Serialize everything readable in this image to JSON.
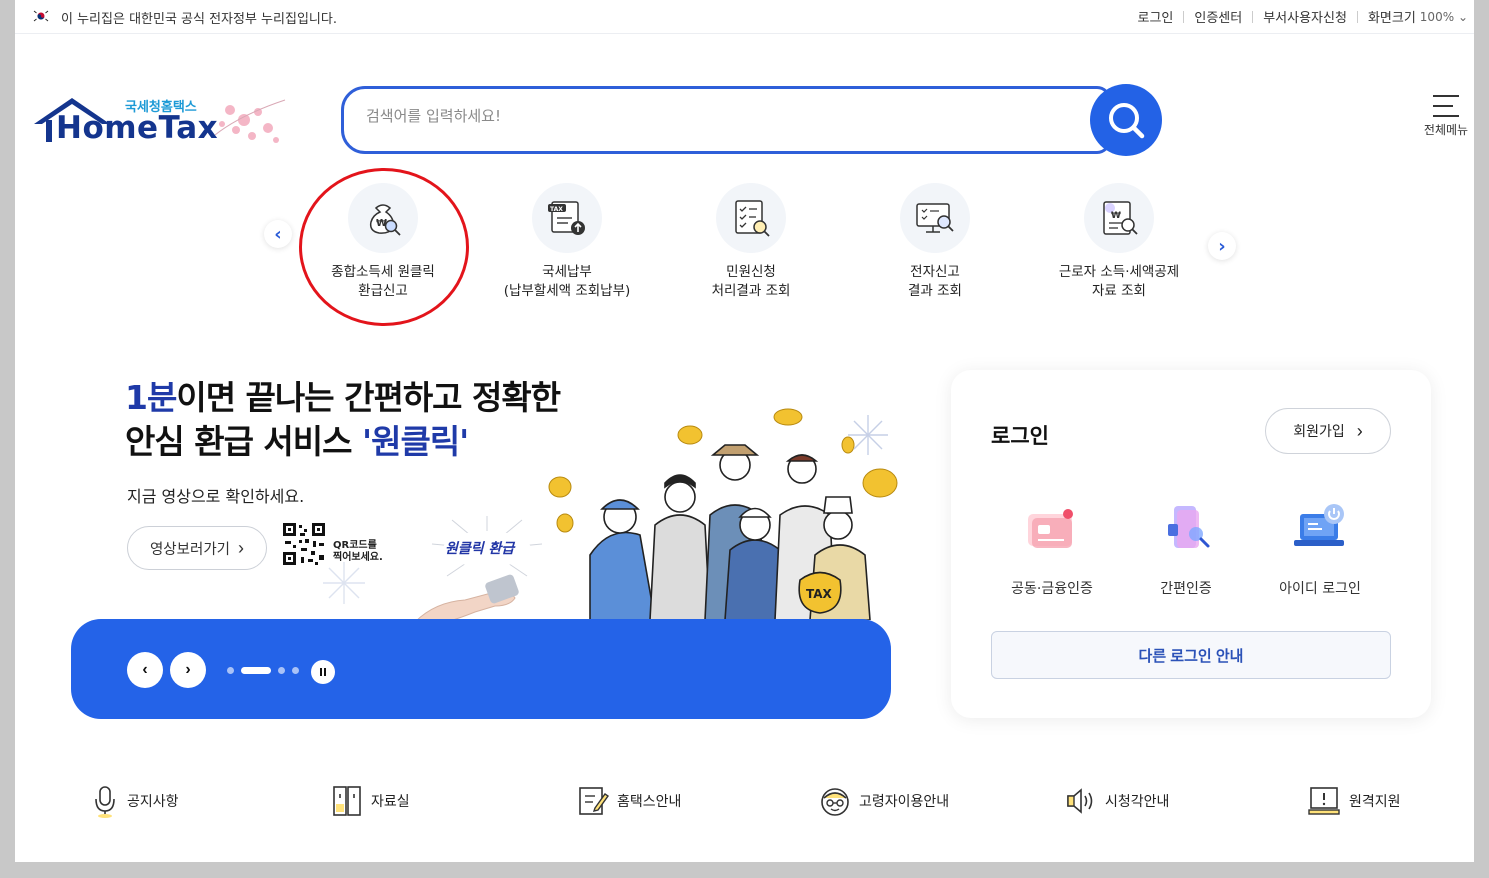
{
  "topbar": {
    "gov_notice": "이 누리집은 대한민국 공식 전자정부 누리집입니다.",
    "login": "로그인",
    "cert_center": "인증센터",
    "dept_user": "부서사용자신청",
    "screen_size": "화면크기",
    "zoom": "100%"
  },
  "logo": {
    "sub": "국세청홈택스",
    "main": "HomeTax"
  },
  "search": {
    "placeholder": "검색어를 입력하세요!"
  },
  "allmenu": {
    "label": "전체메뉴"
  },
  "quick_menu": [
    {
      "label": "종합소득세 원클릭\n환급신고",
      "icon": "money-bag-search-icon"
    },
    {
      "label": "국세납부\n(납부할세액 조회납부)",
      "icon": "tax-document-upload-icon"
    },
    {
      "label": "민원신청\n처리결과 조회",
      "icon": "checklist-search-icon"
    },
    {
      "label": "전자신고\n결과 조회",
      "icon": "monitor-search-icon"
    },
    {
      "label": "근로자 소득·세액공제\n자료 조회",
      "icon": "receipt-search-icon"
    }
  ],
  "banner": {
    "headline_emph": "1분",
    "headline_rest1": "이면 끝나는 간편하고 정확한",
    "headline_line2a": "안심 환급 서비스 ",
    "headline_line2b": "'원클릭'",
    "subline": "지금 영상으로 확인하세요.",
    "video_button": "영상보러가기",
    "qr_label": "QR코드를\n찍어보세요.",
    "oneclick_badge": "원클릭 환급"
  },
  "login_card": {
    "title": "로그인",
    "join": "회원가입",
    "options": [
      {
        "label": "공동·금융인증",
        "icon": "certificate-card-icon"
      },
      {
        "label": "간편인증",
        "icon": "mobile-search-icon"
      },
      {
        "label": "아이디 로그인",
        "icon": "laptop-power-icon"
      }
    ],
    "other_login": "다른 로그인 안내"
  },
  "bottom_links": [
    {
      "label": "공지사항",
      "icon": "microphone-icon"
    },
    {
      "label": "자료실",
      "icon": "cabinet-icon"
    },
    {
      "label": "홈택스안내",
      "icon": "document-edit-icon"
    },
    {
      "label": "고령자이용안내",
      "icon": "elderly-face-icon"
    },
    {
      "label": "시청각안내",
      "icon": "speaker-icon"
    },
    {
      "label": "원격지원",
      "icon": "remote-monitor-icon"
    }
  ],
  "colors": {
    "primary": "#2463e8",
    "logo_navy": "#14358e",
    "highlight_circle": "#e3141b"
  }
}
